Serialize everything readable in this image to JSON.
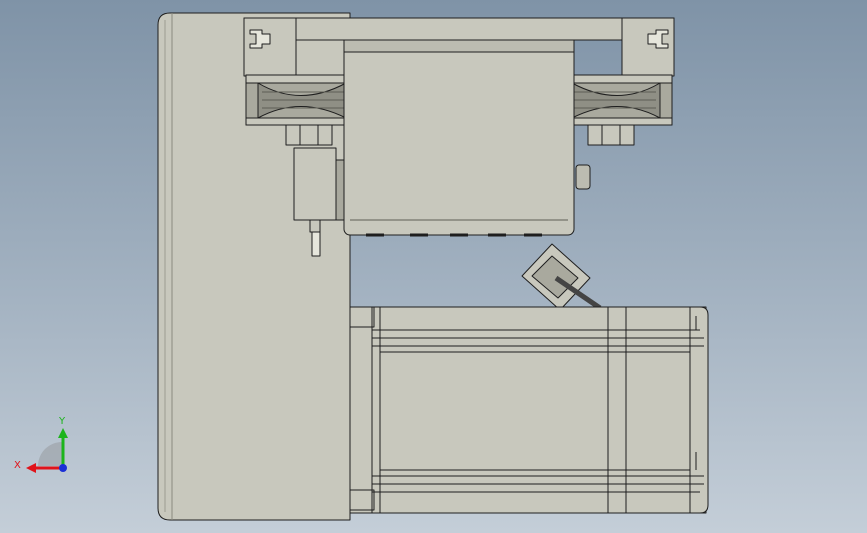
{
  "viewport": {
    "background_top": "#7f93a7",
    "background_bottom": "#c4ced8"
  },
  "model": {
    "body_color": "#c8c8bd",
    "edge_color": "#1e1e1e",
    "shade_color": "#a9a99e",
    "dark_color": "#6c6c62"
  },
  "triad": {
    "x_label": "X",
    "y_label": "Y",
    "x_color": "#e0131a",
    "y_color": "#1cb41c",
    "z_color": "#1a2fd6"
  }
}
